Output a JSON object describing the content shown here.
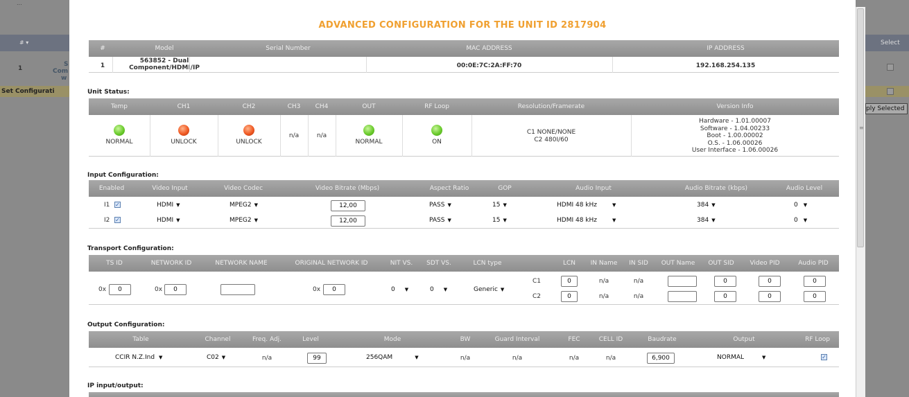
{
  "background": {
    "top_left_text": "...",
    "header_hash": "# ▾",
    "row_num": "1",
    "row_text_line1": "S",
    "row_text_line2": "Com",
    "row_text_line3": "w",
    "set_config": "Set Configurati",
    "select_header": "Select",
    "apply_selected": "ply Selected"
  },
  "title": "ADVANCED CONFIGURATION FOR THE UNIT ID 2817904",
  "unit_table": {
    "headers": [
      "#",
      "Model",
      "Serial Number",
      "MAC ADDRESS",
      "IP ADDRESS"
    ],
    "row": {
      "num": "1",
      "model_line1": "563852 - Dual",
      "model_line2": "Component/HDMI/IP",
      "serial": "",
      "mac": "00:0E:7C:2A:FF:70",
      "ip": "192.168.254.135"
    }
  },
  "unit_status": {
    "title": "Unit Status:",
    "headers": [
      "Temp",
      "CH1",
      "CH2",
      "CH3",
      "CH4",
      "OUT",
      "RF Loop",
      "Resolution/Framerate",
      "Version Info"
    ],
    "temp": {
      "label": "NORMAL",
      "color": "green"
    },
    "ch1": {
      "label": "UNLOCK",
      "color": "red"
    },
    "ch2": {
      "label": "UNLOCK",
      "color": "red"
    },
    "ch3": "n/a",
    "ch4": "n/a",
    "out": {
      "label": "NORMAL",
      "color": "green"
    },
    "rf_loop": {
      "label": "ON",
      "color": "green"
    },
    "resolution_line1": "C1 NONE/NONE",
    "resolution_line2": "C2 480I/60",
    "version": [
      "Hardware - 1.01.00007",
      "Software - 1.04.00233",
      "Boot - 1.00.00002",
      "O.S. - 1.06.00026",
      "User Interface - 1.06.00026"
    ]
  },
  "input_config": {
    "title": "Input Configuration:",
    "headers": [
      "Enabled",
      "Video Input",
      "Video Codec",
      "Video Bitrate (Mbps)",
      "Aspect Ratio",
      "GOP",
      "Audio Input",
      "Audio Bitrate (kbps)",
      "Audio Level"
    ],
    "rows": [
      {
        "label": "I1",
        "enabled": true,
        "video_input": "HDMI",
        "video_codec": "MPEG2",
        "bitrate": "12,00",
        "aspect": "PASS",
        "gop": "15",
        "audio_input": "HDMI 48 kHz",
        "audio_bitrate": "384",
        "audio_level": "0"
      },
      {
        "label": "I2",
        "enabled": true,
        "video_input": "HDMI",
        "video_codec": "MPEG2",
        "bitrate": "12,00",
        "aspect": "PASS",
        "gop": "15",
        "audio_input": "HDMI 48 kHz",
        "audio_bitrate": "384",
        "audio_level": "0"
      }
    ]
  },
  "transport_config": {
    "title": "Transport Configuration:",
    "headers": [
      "TS ID",
      "NETWORK ID",
      "NETWORK NAME",
      "ORIGINAL NETWORK ID",
      "NIT VS.",
      "SDT VS.",
      "LCN type",
      "LCN",
      "IN Name",
      "IN SID",
      "OUT Name",
      "OUT SID",
      "Video PID",
      "Audio PID"
    ],
    "prefix": "0x",
    "ts_id": "0",
    "network_id": "0",
    "network_name": "",
    "orig_network_id": "0",
    "nit_vs": "0",
    "sdt_vs": "0",
    "lcn_type": "Generic",
    "rows": [
      {
        "label": "C1",
        "lcn": "0",
        "in_name": "n/a",
        "in_sid": "n/a",
        "out_name": "",
        "out_sid": "0",
        "video_pid": "0",
        "audio_pid": "0"
      },
      {
        "label": "C2",
        "lcn": "0",
        "in_name": "n/a",
        "in_sid": "n/a",
        "out_name": "",
        "out_sid": "0",
        "video_pid": "0",
        "audio_pid": "0"
      }
    ]
  },
  "output_config": {
    "title": "Output Configuration:",
    "headers": [
      "Table",
      "Channel",
      "Freq. Adj.",
      "Level",
      "Mode",
      "BW",
      "Guard Interval",
      "FEC",
      "CELL ID",
      "Baudrate",
      "Output",
      "RF Loop"
    ],
    "table": "CCIR N.Z.Ind",
    "channel": "C02",
    "freq_adj": "n/a",
    "level": "99",
    "mode": "256QAM",
    "bw": "n/a",
    "guard": "n/a",
    "fec": "n/a",
    "cell_id": "n/a",
    "baudrate": "6,900",
    "output": "NORMAL",
    "rf_loop": true
  },
  "ip_io": {
    "title": "IP input/output:"
  }
}
